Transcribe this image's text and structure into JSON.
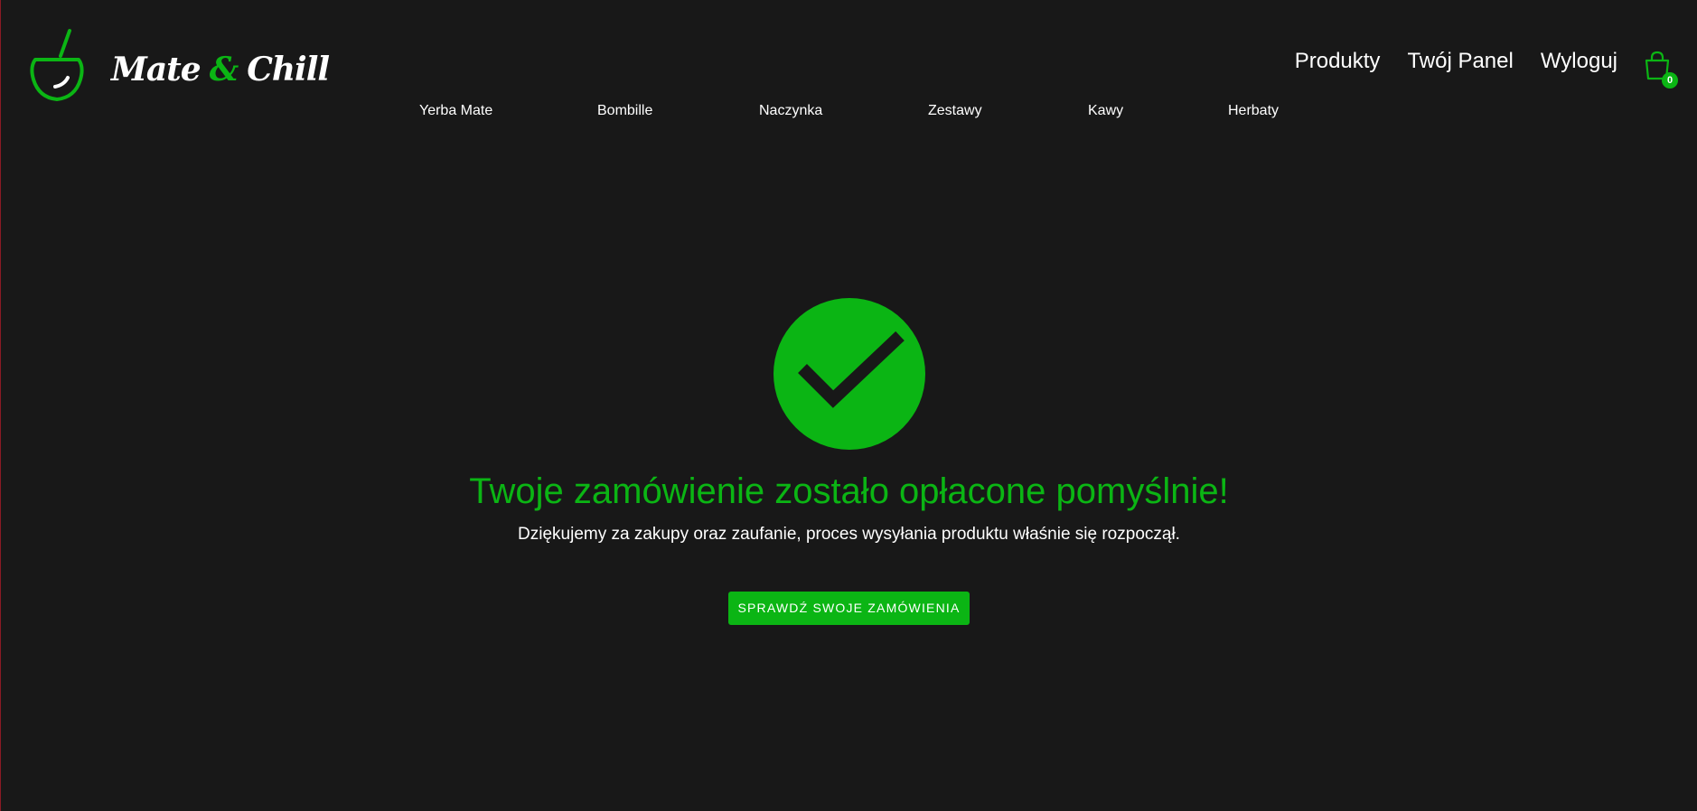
{
  "brand": {
    "name_part1": "Mate",
    "name_amp": "&",
    "name_part2": "Chill",
    "icon": "mate-gourd-icon",
    "accent_color": "#0bb514",
    "background_color": "#181818"
  },
  "top_nav": {
    "items": [
      {
        "label": "Produkty"
      },
      {
        "label": "Twój Panel"
      },
      {
        "label": "Wyloguj"
      }
    ]
  },
  "cart": {
    "icon": "shopping-bag-icon",
    "count": "0"
  },
  "categories": {
    "items": [
      {
        "label": "Yerba Mate"
      },
      {
        "label": "Bombille"
      },
      {
        "label": "Naczynka"
      },
      {
        "label": "Zestawy"
      },
      {
        "label": "Kawy"
      },
      {
        "label": "Herbaty"
      }
    ]
  },
  "success": {
    "icon": "check-circle-icon",
    "title": "Twoje zamówienie zostało opłacone pomyślnie!",
    "subtitle": "Dziękujemy za zakupy oraz zaufanie, proces wysyłania produktu właśnie się rozpoczął.",
    "button_label": "SPRAWDŹ SWOJE ZAMÓWIENIA"
  }
}
